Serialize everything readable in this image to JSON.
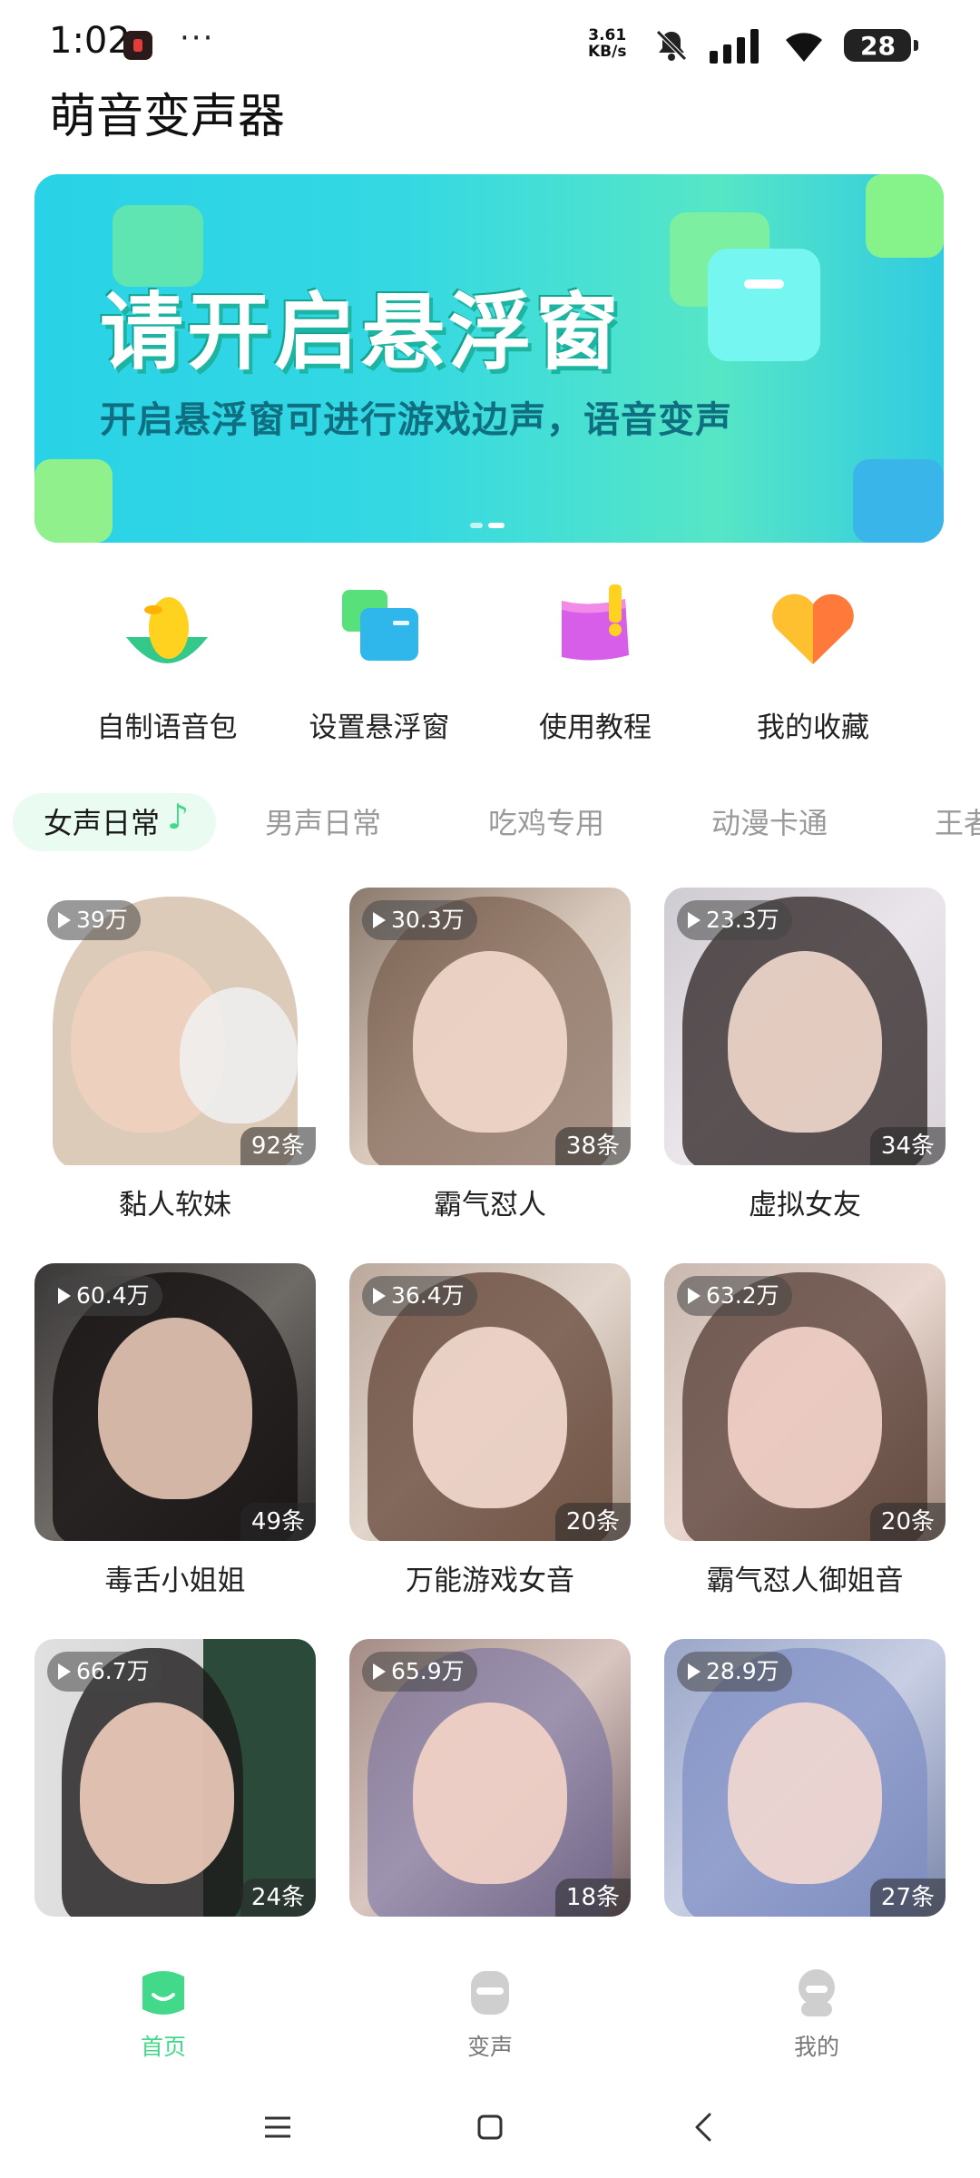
{
  "status_bar": {
    "time": "1:02",
    "more": "···",
    "net_speed_value": "3.61",
    "net_speed_unit": "KB/s",
    "battery": "28"
  },
  "app": {
    "title": "萌音变声器"
  },
  "banner": {
    "headline": "请开启悬浮窗",
    "subtitle": "开启悬浮窗可进行游戏边声，语音变声"
  },
  "quick_actions": [
    {
      "label": "自制语音包",
      "icon": "duck-icon"
    },
    {
      "label": "设置悬浮窗",
      "icon": "floating-window-icon"
    },
    {
      "label": "使用教程",
      "icon": "tutorial-book-icon"
    },
    {
      "label": "我的收藏",
      "icon": "heart-icon"
    }
  ],
  "tabs": [
    {
      "label": "女声日常",
      "active": true
    },
    {
      "label": "男声日常"
    },
    {
      "label": "吃鸡专用"
    },
    {
      "label": "动漫卡通"
    },
    {
      "label": "王者"
    }
  ],
  "cards": [
    {
      "plays": "39万",
      "count": "92条",
      "name": "黏人软妹"
    },
    {
      "plays": "30.3万",
      "count": "38条",
      "name": "霸气怼人"
    },
    {
      "plays": "23.3万",
      "count": "34条",
      "name": "虚拟女友"
    },
    {
      "plays": "60.4万",
      "count": "49条",
      "name": "毒舌小姐姐"
    },
    {
      "plays": "36.4万",
      "count": "20条",
      "name": "万能游戏女音"
    },
    {
      "plays": "63.2万",
      "count": "20条",
      "name": "霸气怼人御姐音"
    },
    {
      "plays": "66.7万",
      "count": "24条",
      "name": ""
    },
    {
      "plays": "65.9万",
      "count": "18条",
      "name": ""
    },
    {
      "plays": "28.9万",
      "count": "27条",
      "name": ""
    }
  ],
  "bottom_nav": [
    {
      "label": "首页",
      "active": true
    },
    {
      "label": "变声"
    },
    {
      "label": "我的"
    }
  ],
  "colors": {
    "accent": "#43d98b"
  }
}
